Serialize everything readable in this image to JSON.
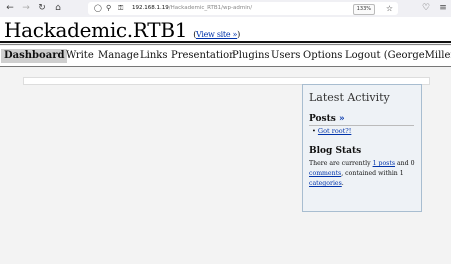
{
  "browser": {
    "url_host": "192.168.1.19",
    "url_path": "/Hackademic_RTB1/wp-admin/",
    "zoom": "133%"
  },
  "header": {
    "blog_title": "Hackademic.RTB1",
    "view_site_open": "(",
    "view_site_label": "View site »",
    "view_site_close": ")"
  },
  "menu": {
    "items": [
      {
        "label": "Dashboard"
      },
      {
        "label": "Write"
      },
      {
        "label": "Manage"
      },
      {
        "label": "Links"
      },
      {
        "label": "Presentation"
      },
      {
        "label": "Plugins"
      },
      {
        "label": "Users"
      },
      {
        "label": "Options"
      },
      {
        "label": "Logout (GeorgeMiller)"
      }
    ]
  },
  "activity": {
    "title": "Latest Activity",
    "posts_heading": "Posts",
    "posts_link": "»",
    "posts": [
      "Got root?!"
    ],
    "stats_heading": "Blog Stats",
    "stats_prefix": "There are currently ",
    "stats_posts": "1 posts",
    "stats_and": " and 0 ",
    "stats_comments": "comments",
    "stats_within": ", contained within 1 ",
    "stats_categories": "categories",
    "stats_end": "."
  },
  "colors": {
    "link": "#0033aa",
    "activity_bg": "#eef2f6",
    "activity_border": "#a8bdd0"
  }
}
